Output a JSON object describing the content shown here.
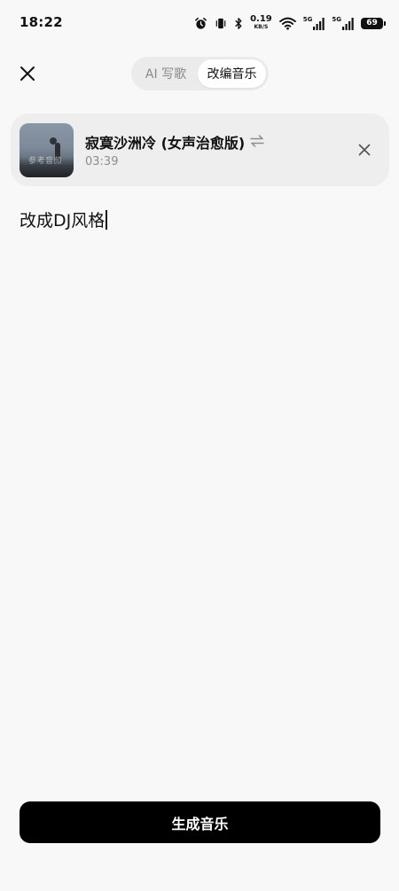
{
  "status_bar": {
    "time": "18:22",
    "net_speed_value": "0.19",
    "net_speed_unit": "KB/S",
    "signal1_label": "5G",
    "signal2_label": "5G",
    "battery": "69",
    "icons": [
      "alarm-icon",
      "vibrate-icon",
      "bluetooth-icon",
      "wifi-icon",
      "signal-icon",
      "battery-icon"
    ]
  },
  "header": {
    "tabs": [
      {
        "label": "AI 写歌",
        "active": false
      },
      {
        "label": "改编音乐",
        "active": true
      }
    ]
  },
  "song": {
    "title": "寂寞沙洲冷 (女声治愈版)",
    "duration": "03:39",
    "cover_watermark": "参考音频"
  },
  "prompt": {
    "value": "改成DJ风格"
  },
  "actions": {
    "generate_label": "生成音乐"
  },
  "colors": {
    "background": "#f8f8f8",
    "card": "#eeeeee",
    "primary_button": "#000000",
    "muted_text": "#8c8c8c"
  }
}
